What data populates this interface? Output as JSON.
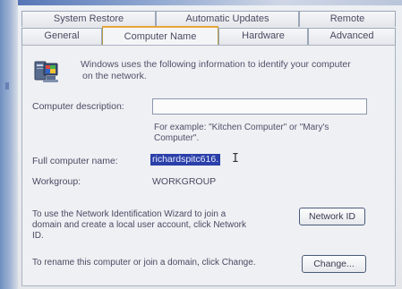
{
  "tabs_back": [
    {
      "label": "System Restore"
    },
    {
      "label": "Automatic Updates"
    },
    {
      "label": "Remote"
    }
  ],
  "tabs_front": [
    {
      "label": "General"
    },
    {
      "label": "Computer Name"
    },
    {
      "label": "Hardware"
    },
    {
      "label": "Advanced"
    }
  ],
  "active_tab": "Computer Name",
  "intro": {
    "icon": "computer-icon",
    "line1": "Windows uses the following information to identify your computer",
    "line2": "on the network."
  },
  "fields": {
    "description_label": "Computer description:",
    "description_value": "",
    "example_line1": "For example: \"Kitchen Computer\" or \"Mary's",
    "example_line2": "Computer\".",
    "full_name_label": "Full computer name:",
    "full_name_value": "richardspitc616.",
    "workgroup_label": "Workgroup:",
    "workgroup_value": "WORKGROUP"
  },
  "network_id": {
    "line1": "To use the Network Identification Wizard to join a",
    "line2": "domain and create a local user account, click Network",
    "line3": "ID.",
    "button": "Network ID"
  },
  "change": {
    "text": "To rename this computer or join a domain, click Change.",
    "button": "Change..."
  },
  "colors": {
    "selection": "#2a3fa8",
    "active_tab_accent": "#e8a43a"
  }
}
